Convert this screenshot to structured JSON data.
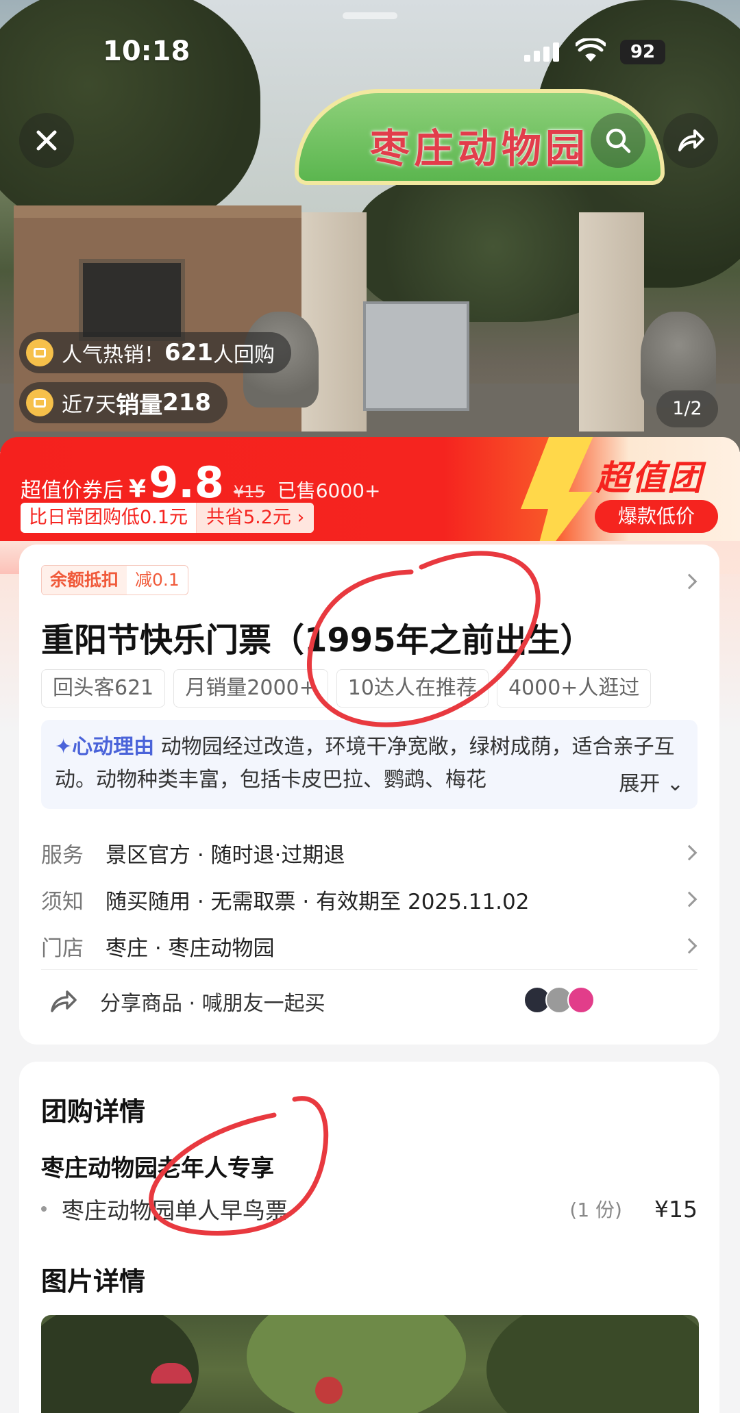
{
  "status": {
    "time": "10:18",
    "battery": "92"
  },
  "hero": {
    "sign_text": "枣庄动物园",
    "badge1": {
      "text": "人气热销！",
      "count": "621",
      "suffix": "人回购"
    },
    "badge2": {
      "text": "近7天",
      "label": "销量",
      "count": "218"
    },
    "pager": "1/2"
  },
  "banner": {
    "label": "超值价券后",
    "currency": "¥",
    "price": "9.8",
    "original": "¥15",
    "sold": "已售6000+",
    "compare": "比日常团购低0.1元",
    "saved": "共省5.2元 ›",
    "brand": "超值团",
    "hot": "爆款低价"
  },
  "product": {
    "coupon_label": "余额抵扣",
    "coupon_value": "减0.1",
    "title": "重阳节快乐门票（1995年之前出生）",
    "tags": [
      "回头客621",
      "月销量2000+",
      "10达人在推荐",
      "4000+人逛过"
    ],
    "reason_label": "✦心动理由",
    "reason_text": "动物园经过改造，环境干净宽敞，绿树成荫，适合亲子互动。动物种类丰富，包括卡皮巴拉、鹦鹉、梅花",
    "reason_more": "展开 ⌄",
    "info": [
      {
        "key": "服务",
        "value": "景区官方 · 随时退·过期退"
      },
      {
        "key": "须知",
        "value": "随买随用 · 无需取票 · 有效期至 2025.11.02"
      },
      {
        "key": "门店",
        "value": "枣庄 · 枣庄动物园"
      }
    ],
    "share_text": "分享商品 · 喊朋友一起买"
  },
  "details": {
    "heading": "团购详情",
    "package_name": "枣庄动物园老年人专享",
    "item_name": "枣庄动物园单人早鸟票",
    "item_qty": "(1 份)",
    "item_price": "¥15",
    "photo_heading": "图片详情"
  },
  "colors": {
    "accent": "#f5241f",
    "reason_blue": "#4a63d9",
    "annotation": "#e8393f"
  }
}
